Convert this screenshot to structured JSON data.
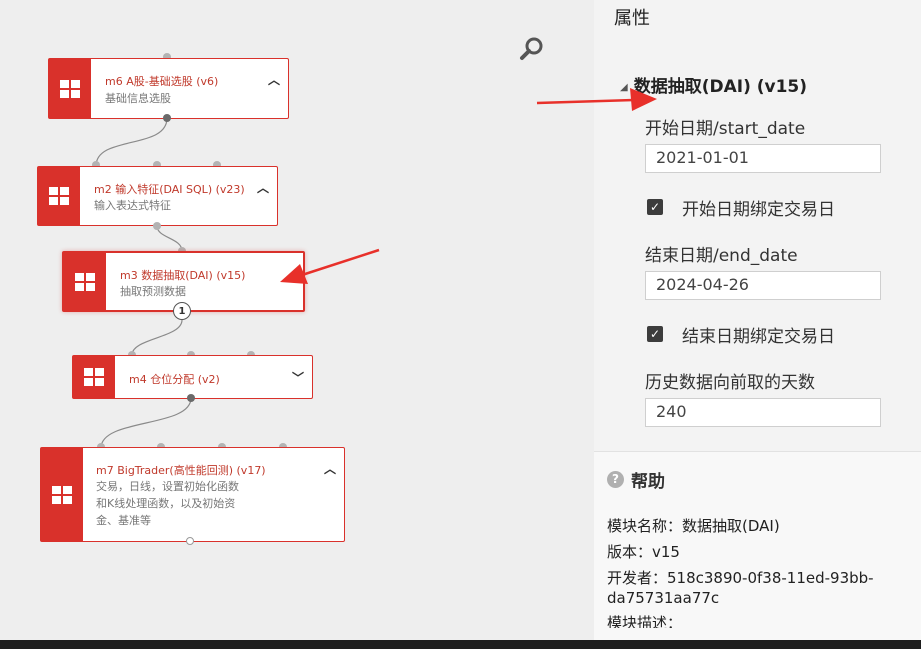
{
  "properties": {
    "title": "属性",
    "section_title": "数据抽取(DAI) (v15)",
    "start_date_label": "开始日期/start_date",
    "start_date_value": "2021-01-01",
    "start_bind_label": "开始日期绑定交易日",
    "end_date_label": "结束日期/end_date",
    "end_date_value": "2024-04-26",
    "end_bind_label": "结束日期绑定交易日",
    "history_days_label": "历史数据向前取的天数",
    "history_days_value": "240"
  },
  "help": {
    "title": "帮助",
    "module_name": "模块名称：数据抽取(DAI)",
    "version": "版本：v15",
    "developer_line1": "开发者：518c3890-0f38-11ed-93bb-",
    "developer_line2": "da75731aa77c",
    "description": "模块描述："
  },
  "nodes": [
    {
      "title": "m6 A股-基础选股 (v6)",
      "subtitle": "基础信息选股"
    },
    {
      "title": "m2 输入特征(DAI SQL) (v23)",
      "subtitle": "输入表达式特征"
    },
    {
      "title": "m3 数据抽取(DAI) (v15)",
      "subtitle": "抽取预测数据",
      "badge": "1"
    },
    {
      "title": "m4 仓位分配 (v2)"
    },
    {
      "title": "m7 BigTrader(高性能回测) (v17)",
      "subtitle_lines": [
        "交易，日线，设置初始化函数",
        "和K线处理函数，以及初始资",
        "金、基准等"
      ]
    }
  ],
  "colors": {
    "accent": "#d9312b",
    "annotation_arrow": "#e8302a"
  }
}
